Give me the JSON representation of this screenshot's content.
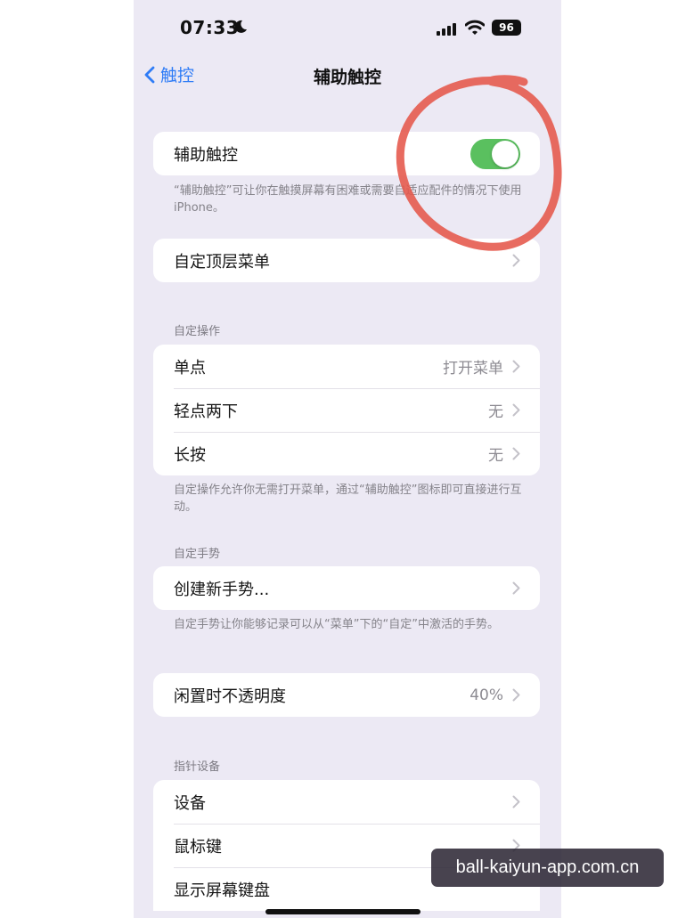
{
  "status_bar": {
    "time": "07:33",
    "battery": "96",
    "icons": [
      "moon-icon",
      "cellular-signal-icon",
      "wifi-icon",
      "battery-icon"
    ]
  },
  "nav": {
    "back_label": "触控",
    "title": "辅助触控"
  },
  "main_toggle": {
    "label": "辅助触控",
    "on": true,
    "footnote": "“辅助触控”可让你在触摸屏幕有困难或需要自适应配件的情况下使用iPhone。"
  },
  "top_menu": {
    "label": "自定顶层菜单"
  },
  "custom_actions": {
    "header": "自定操作",
    "rows": [
      {
        "label": "单点",
        "value": "打开菜单"
      },
      {
        "label": "轻点两下",
        "value": "无"
      },
      {
        "label": "长按",
        "value": "无"
      }
    ],
    "footnote": "自定操作允许你无需打开菜单，通过“辅助触控”图标即可直接进行互动。"
  },
  "custom_gestures": {
    "header": "自定手势",
    "create_label": "创建新手势...",
    "footnote": "自定手势让你能够记录可以从“菜单”下的“自定”中激活的手势。"
  },
  "idle_opacity": {
    "label": "闲置时不透明度",
    "value": "40%"
  },
  "pointer_devices": {
    "header": "指针设备",
    "rows": [
      {
        "label": "设备"
      },
      {
        "label": "鼠标键"
      },
      {
        "label": "显示屏幕键盘"
      }
    ]
  },
  "watermark": "ball-kaiyun-app.com.cn",
  "colors": {
    "accent": "#2f7cf6",
    "toggle_on": "#5ac05f",
    "annotation": "#e5574a",
    "background": "#ece9f4"
  }
}
